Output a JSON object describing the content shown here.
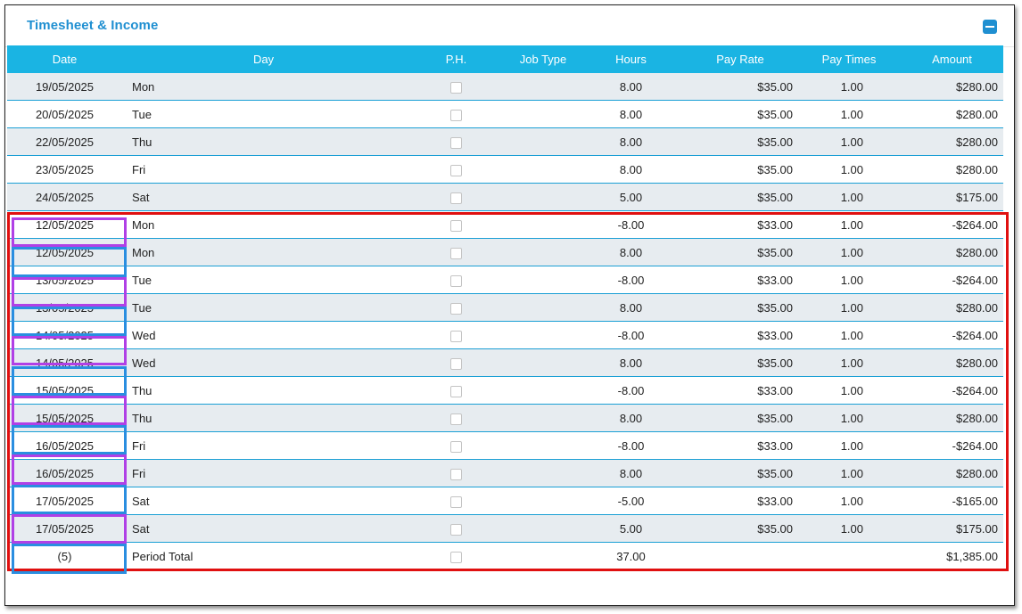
{
  "panel": {
    "title": "Timesheet & Income",
    "collapse_icon": "minus-square-icon"
  },
  "columns": [
    "Date",
    "Day",
    "P.H.",
    "Job Type",
    "Hours",
    "Pay Rate",
    "Pay Times",
    "Amount"
  ],
  "rows": [
    {
      "date": "19/05/2025",
      "day": "Mon",
      "ph": false,
      "job": "",
      "hours": "8.00",
      "rate": "$35.00",
      "times": "1.00",
      "amount": "$280.00"
    },
    {
      "date": "20/05/2025",
      "day": "Tue",
      "ph": false,
      "job": "",
      "hours": "8.00",
      "rate": "$35.00",
      "times": "1.00",
      "amount": "$280.00"
    },
    {
      "date": "22/05/2025",
      "day": "Thu",
      "ph": false,
      "job": "",
      "hours": "8.00",
      "rate": "$35.00",
      "times": "1.00",
      "amount": "$280.00"
    },
    {
      "date": "23/05/2025",
      "day": "Fri",
      "ph": false,
      "job": "",
      "hours": "8.00",
      "rate": "$35.00",
      "times": "1.00",
      "amount": "$280.00"
    },
    {
      "date": "24/05/2025",
      "day": "Sat",
      "ph": false,
      "job": "",
      "hours": "5.00",
      "rate": "$35.00",
      "times": "1.00",
      "amount": "$175.00"
    },
    {
      "date": "12/05/2025",
      "day": "Mon",
      "ph": false,
      "job": "",
      "hours": "-8.00",
      "rate": "$33.00",
      "times": "1.00",
      "amount": "-$264.00"
    },
    {
      "date": "12/05/2025",
      "day": "Mon",
      "ph": false,
      "job": "",
      "hours": "8.00",
      "rate": "$35.00",
      "times": "1.00",
      "amount": "$280.00"
    },
    {
      "date": "13/05/2025",
      "day": "Tue",
      "ph": false,
      "job": "",
      "hours": "-8.00",
      "rate": "$33.00",
      "times": "1.00",
      "amount": "-$264.00"
    },
    {
      "date": "13/05/2025",
      "day": "Tue",
      "ph": false,
      "job": "",
      "hours": "8.00",
      "rate": "$35.00",
      "times": "1.00",
      "amount": "$280.00"
    },
    {
      "date": "14/05/2025",
      "day": "Wed",
      "ph": false,
      "job": "",
      "hours": "-8.00",
      "rate": "$33.00",
      "times": "1.00",
      "amount": "-$264.00"
    },
    {
      "date": "14/05/2025",
      "day": "Wed",
      "ph": false,
      "job": "",
      "hours": "8.00",
      "rate": "$35.00",
      "times": "1.00",
      "amount": "$280.00"
    },
    {
      "date": "15/05/2025",
      "day": "Thu",
      "ph": false,
      "job": "",
      "hours": "-8.00",
      "rate": "$33.00",
      "times": "1.00",
      "amount": "-$264.00"
    },
    {
      "date": "15/05/2025",
      "day": "Thu",
      "ph": false,
      "job": "",
      "hours": "8.00",
      "rate": "$35.00",
      "times": "1.00",
      "amount": "$280.00"
    },
    {
      "date": "16/05/2025",
      "day": "Fri",
      "ph": false,
      "job": "",
      "hours": "-8.00",
      "rate": "$33.00",
      "times": "1.00",
      "amount": "-$264.00"
    },
    {
      "date": "16/05/2025",
      "day": "Fri",
      "ph": false,
      "job": "",
      "hours": "8.00",
      "rate": "$35.00",
      "times": "1.00",
      "amount": "$280.00"
    },
    {
      "date": "17/05/2025",
      "day": "Sat",
      "ph": false,
      "job": "",
      "hours": "-5.00",
      "rate": "$33.00",
      "times": "1.00",
      "amount": "-$165.00"
    },
    {
      "date": "17/05/2025",
      "day": "Sat",
      "ph": false,
      "job": "",
      "hours": "5.00",
      "rate": "$35.00",
      "times": "1.00",
      "amount": "$175.00"
    }
  ],
  "footer": {
    "count": "(5)",
    "label": "Period Total",
    "hours": "37.00",
    "amount": "$1,385.00"
  },
  "annotations": {
    "region_color": "#e01010",
    "reversal_color": "#b040e6",
    "correction_color": "#2a8ee0"
  }
}
